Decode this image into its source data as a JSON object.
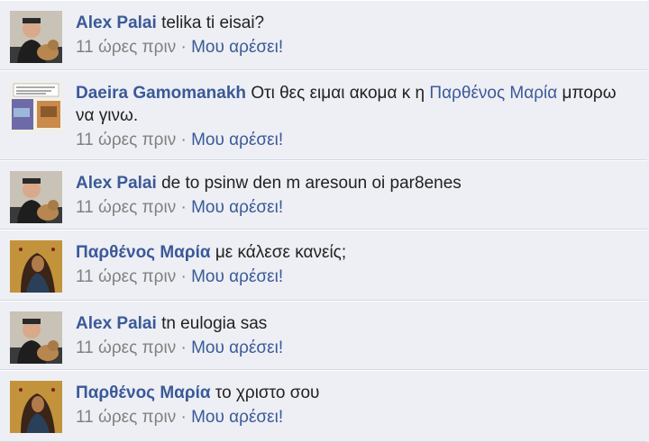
{
  "comments": [
    {
      "avatar": "user-photo-alex",
      "author": "Alex Palai",
      "text": "telika ti eisai?",
      "text_link": "",
      "text_after": "",
      "time": "11 ώρες πριν",
      "separator": "·",
      "like": "Μου αρέσει!"
    },
    {
      "avatar": "user-photo-daeira",
      "author": "Daeira Gamomanakh",
      "text": "Οτι θες ειμαι ακομα κ η",
      "text_link": "Παρθένος Μαρία",
      "text_after": "μπορω να γινω.",
      "time": "11 ώρες πριν",
      "separator": "·",
      "like": "Μου αρέσει!"
    },
    {
      "avatar": "user-photo-alex",
      "author": "Alex Palai",
      "text": "de to psinw den m aresoun oi par8enes",
      "text_link": "",
      "text_after": "",
      "time": "11 ώρες πριν",
      "separator": "·",
      "like": "Μου αρέσει!"
    },
    {
      "avatar": "user-photo-icon-virgin-mary",
      "author": "Παρθένος Μαρία",
      "text": "με κάλεσε κανείς;",
      "text_link": "",
      "text_after": "",
      "time": "11 ώρες πριν",
      "separator": "·",
      "like": "Μου αρέσει!"
    },
    {
      "avatar": "user-photo-alex",
      "author": "Alex Palai",
      "text": "tn eulogia sas",
      "text_link": "",
      "text_after": "",
      "time": "11 ώρες πριν",
      "separator": "·",
      "like": "Μου αρέσει!"
    },
    {
      "avatar": "user-photo-icon-virgin-mary",
      "author": "Παρθένος Μαρία",
      "text": "το χριστο σου",
      "text_link": "",
      "text_after": "",
      "time": "11 ώρες πριν",
      "separator": "·",
      "like": "Μου αρέσει!"
    }
  ],
  "colors": {
    "link": "#3b5998",
    "meta": "#808080",
    "background": "#edeff4"
  }
}
